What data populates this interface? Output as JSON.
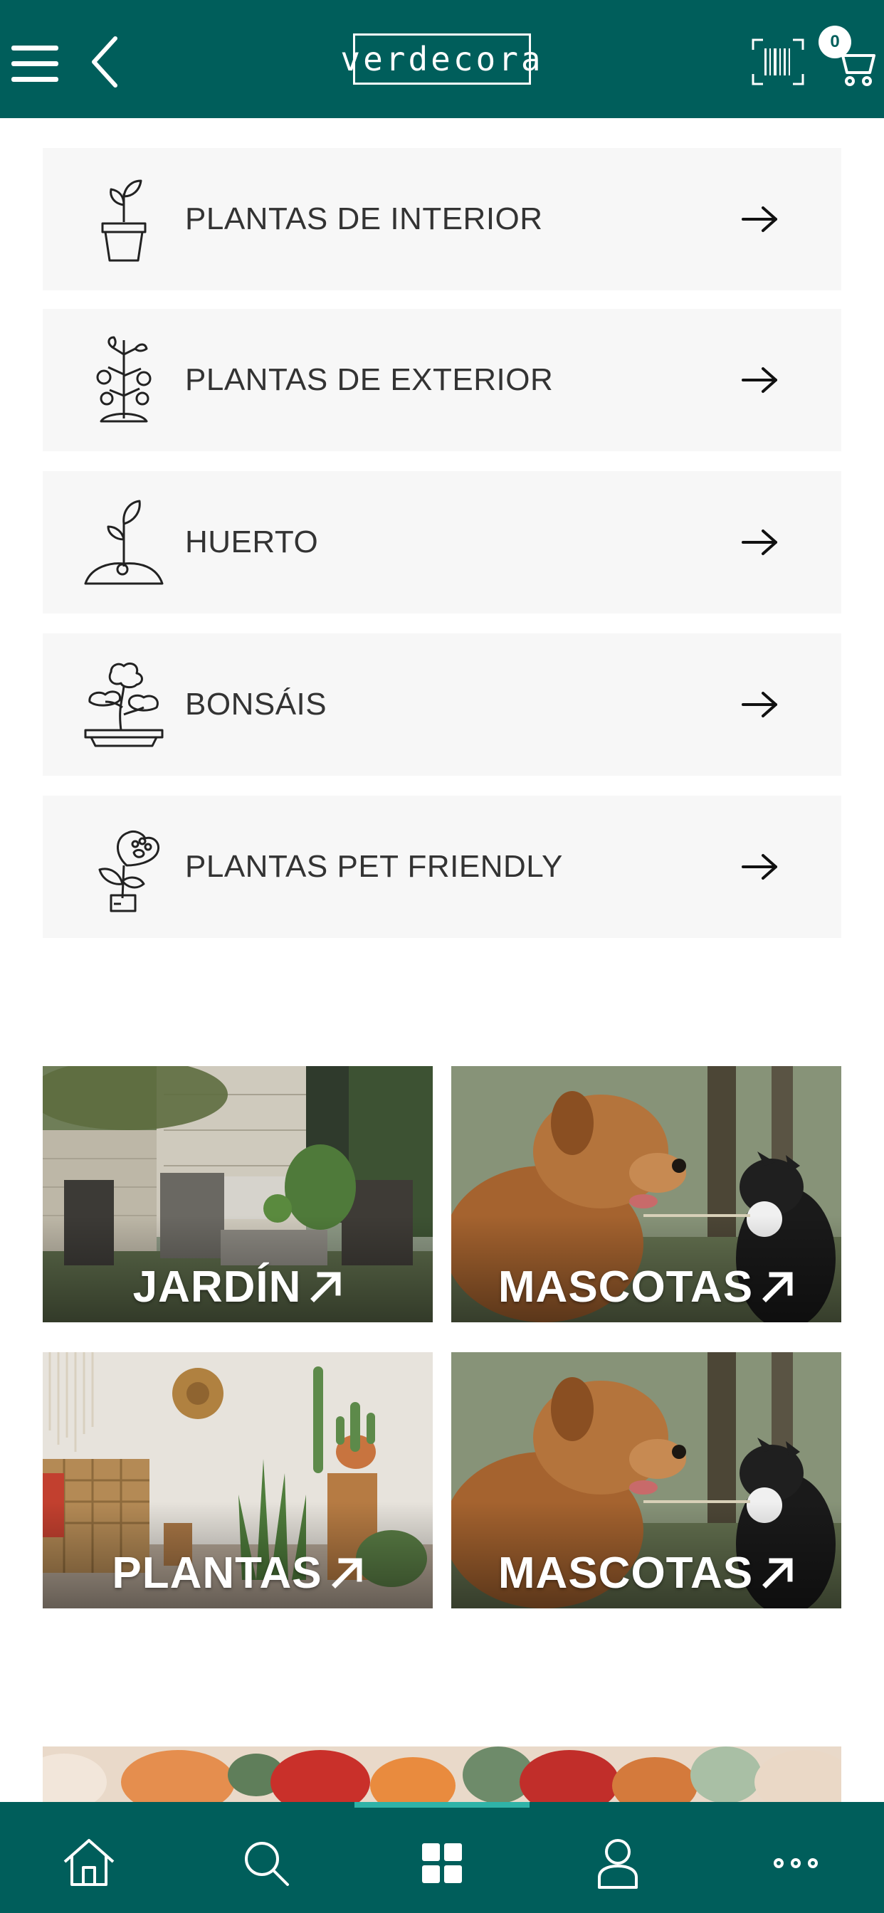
{
  "header": {
    "logo_text": "verdecora",
    "cart_count": "0",
    "background_color": "#005e5b"
  },
  "categories": [
    {
      "label": "PLANTAS DE INTERIOR",
      "icon": "potted-plant-icon"
    },
    {
      "label": "PLANTAS DE EXTERIOR",
      "icon": "fruit-tree-icon"
    },
    {
      "label": "HUERTO",
      "icon": "sprout-icon"
    },
    {
      "label": "BONSÁIS",
      "icon": "bonsai-icon"
    },
    {
      "label": "PLANTAS PET FRIENDLY",
      "icon": "pet-friendly-plant-icon"
    }
  ],
  "tiles": [
    {
      "label": "JARDÍN",
      "image": "garden-patio-furniture"
    },
    {
      "label": "MASCOTAS",
      "image": "dog-and-cat"
    },
    {
      "label": "PLANTAS",
      "image": "indoor-plants-room"
    },
    {
      "label": "MASCOTAS",
      "image": "dog-and-cat"
    }
  ],
  "bottom_nav": {
    "items": [
      "home-icon",
      "search-icon",
      "categories-grid-icon",
      "profile-icon",
      "more-icon"
    ],
    "active": "categories-grid-icon"
  }
}
